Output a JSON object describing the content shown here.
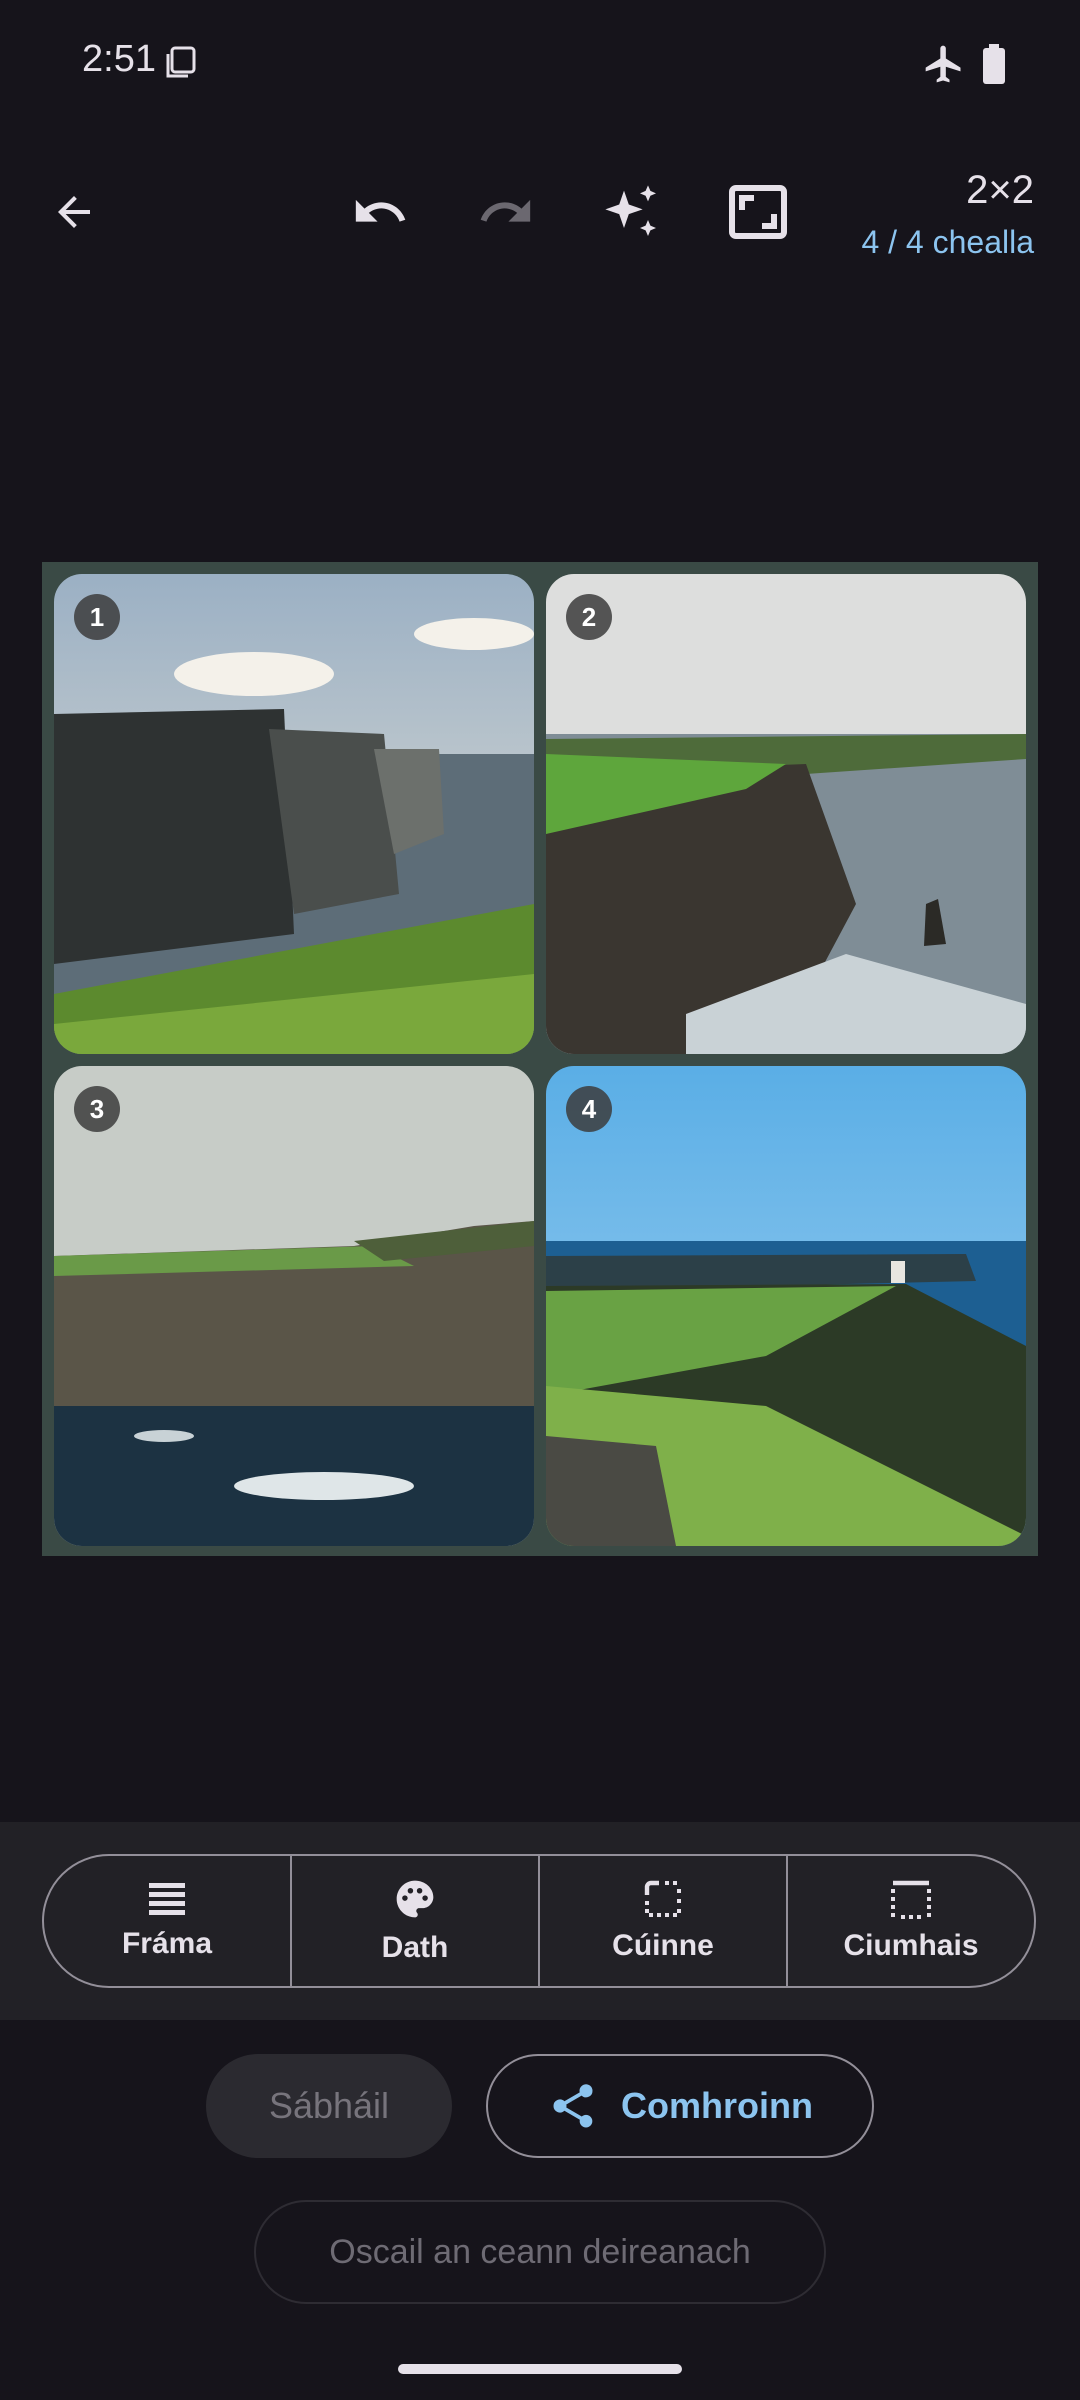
{
  "status_bar": {
    "time": "2:51"
  },
  "toolbar": {
    "grid_size": "2×2",
    "cells_count": "4 / 4 chealla",
    "icons": [
      "back-arrow-icon",
      "undo-icon",
      "redo-icon",
      "magic-sparkle-icon",
      "fit-frame-icon"
    ]
  },
  "collage": {
    "cells": [
      {
        "number": "1",
        "scene": "cliffs-sunrays"
      },
      {
        "number": "2",
        "scene": "cliffs-sea-stack"
      },
      {
        "number": "3",
        "scene": "cliffs-from-sea"
      },
      {
        "number": "4",
        "scene": "cliffs-tower-blue-sky"
      }
    ]
  },
  "tools": [
    {
      "label": "Fráma",
      "icon": "frame-lines-icon"
    },
    {
      "label": "Dath",
      "icon": "palette-icon"
    },
    {
      "label": "Cúinne",
      "icon": "corner-icon"
    },
    {
      "label": "Ciumhais",
      "icon": "border-icon"
    }
  ],
  "actions": {
    "save": "Sábháil",
    "share": "Comhroinn",
    "open_last": "Oscail an ceann deireanach"
  },
  "colors": {
    "background": "#16141b",
    "accent": "#8cc4ef",
    "collage_border": "#3a4a45"
  }
}
